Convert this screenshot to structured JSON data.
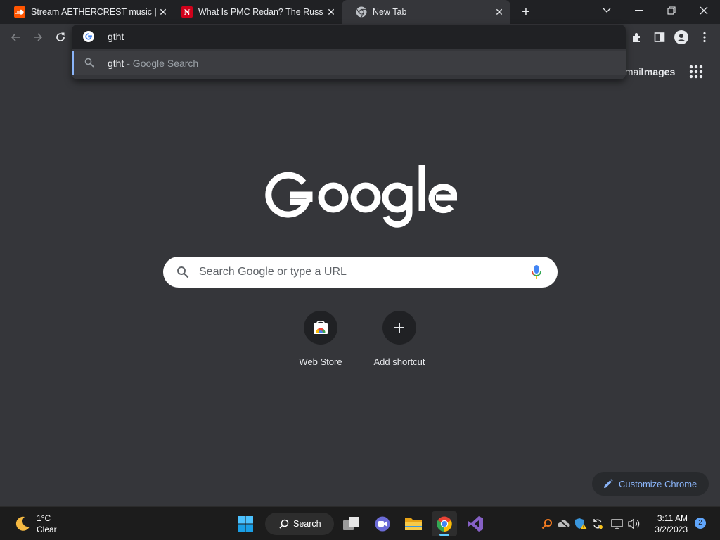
{
  "tabs": [
    {
      "title": "Stream AETHERCREST music | Listen",
      "icon": "soundcloud-icon",
      "active": false
    },
    {
      "title": "What Is PMC Redan? The Russian",
      "icon": "newsweek-icon",
      "active": false
    },
    {
      "title": "New Tab",
      "icon": "chrome-icon",
      "active": true
    }
  ],
  "omnibox": {
    "text": "gtht",
    "suggestion_query": "gtht",
    "suggestion_suffix": " - Google Search"
  },
  "ntp": {
    "header_links": {
      "gmail": "Gmail",
      "images": "Images"
    },
    "search_placeholder": "Search Google or type a URL",
    "shortcuts": [
      {
        "label": "Web Store",
        "icon": "web-store-icon"
      },
      {
        "label": "Add shortcut",
        "icon": "plus-icon"
      }
    ],
    "customize_label": "Customize Chrome"
  },
  "taskbar": {
    "weather_temp": "1°C",
    "weather_condition": "Clear",
    "search_label": "Search",
    "clock_time": "3:11 AM",
    "clock_date": "3/2/2023",
    "notification_count": "2"
  },
  "colors": {
    "tabstrip_bg": "#202124",
    "toolbar_bg": "#35363a",
    "accent_blue": "#8ab4f8",
    "taskbar_bg": "#1c1c1c"
  }
}
